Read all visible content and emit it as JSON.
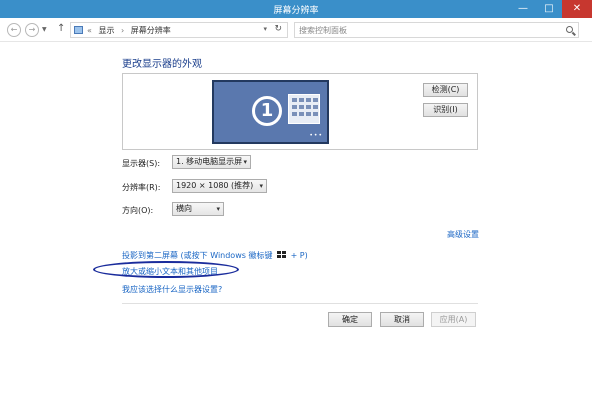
{
  "window": {
    "title": "屏幕分辨率",
    "minimize": "—",
    "maximize": "□",
    "close": "✕"
  },
  "addressbar": {
    "back": "←",
    "forward": "→",
    "up": "↑",
    "separator": "«",
    "crumbs": [
      "显示",
      "屏幕分辨率"
    ],
    "crumb_sep": "›",
    "refresh": "↻",
    "search_placeholder": "搜索控制面板"
  },
  "main": {
    "heading": "更改显示器的外观",
    "monitor_number": "1",
    "monitor_dots": "•••",
    "detect_label": "检测(C)",
    "identify_label": "识别(I)",
    "display_label": "显示器(S):",
    "display_value": "1. 移动电脑显示屏",
    "resolution_label": "分辨率(R):",
    "resolution_value": "1920 × 1080 (推荐)",
    "orientation_label": "方向(O):",
    "orientation_value": "横向",
    "advanced_link": "高级设置",
    "project_text_before": "投影到第二屏幕 (或按下 Windows 徽标键",
    "project_text_after": "+ P)",
    "text_size_link": "放大或缩小文本和其他项目",
    "which_settings_link": "我应该选择什么显示器设置?"
  },
  "footer": {
    "ok": "确定",
    "cancel": "取消",
    "apply": "应用(A)"
  },
  "colors": {
    "titlebar": "#3a8fc9",
    "link": "#1a66c4",
    "heading": "#1a3e8c",
    "monitor": "#5a78ae",
    "annotation_ellipse": "#1a2c9c"
  }
}
